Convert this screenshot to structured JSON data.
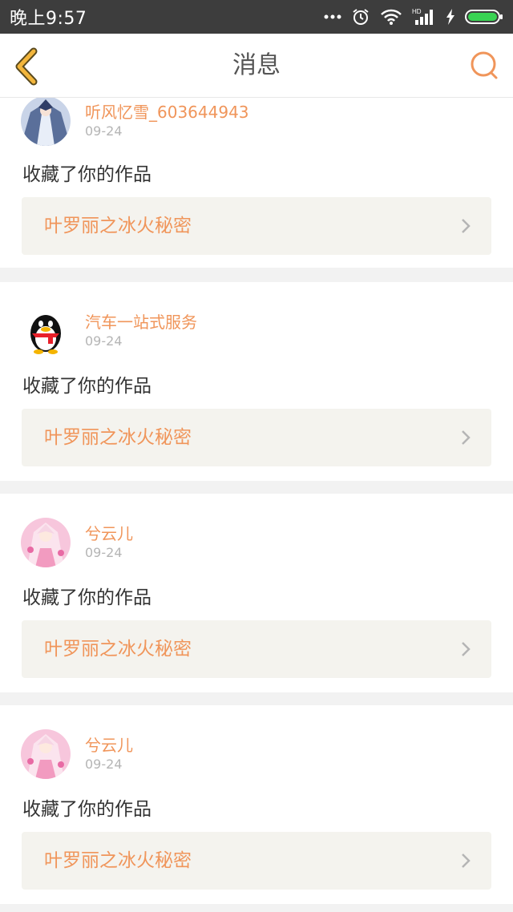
{
  "status_bar": {
    "time": "晚上9:57",
    "icons": [
      "more-dots-icon",
      "alarm-icon",
      "wifi-icon",
      "hd-signal-icon",
      "charging-icon",
      "battery-icon"
    ]
  },
  "header": {
    "title": "消息",
    "back_icon": "chevron-left-icon",
    "search_icon": "search-icon"
  },
  "colors": {
    "accent": "#f0955a",
    "back_icon": "#f3b63c",
    "status_bar_bg": "#3d3d3d"
  },
  "messages": [
    {
      "user": "听风忆雪_603644943",
      "date": "09-24",
      "action": "收藏了你的作品",
      "work_title": "叶罗丽之冰火秘密",
      "avatar": "anime-blue-avatar"
    },
    {
      "user": "汽车一站式服务",
      "date": "09-24",
      "action": "收藏了你的作品",
      "work_title": "叶罗丽之冰火秘密",
      "avatar": "qq-penguin-avatar"
    },
    {
      "user": "兮云儿",
      "date": "09-24",
      "action": "收藏了你的作品",
      "work_title": "叶罗丽之冰火秘密",
      "avatar": "anime-pink-avatar"
    },
    {
      "user": "兮云儿",
      "date": "09-24",
      "action": "收藏了你的作品",
      "work_title": "叶罗丽之冰火秘密",
      "avatar": "anime-pink-avatar"
    }
  ]
}
